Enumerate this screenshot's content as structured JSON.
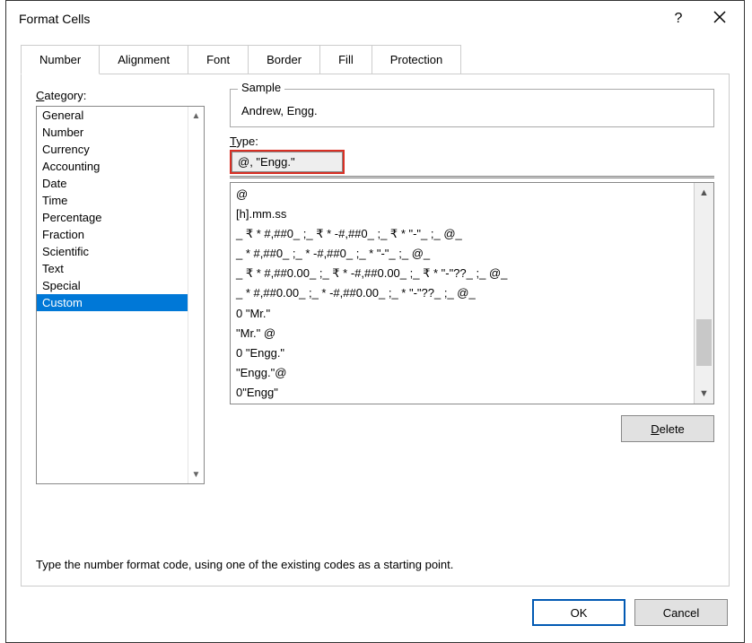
{
  "dialog": {
    "title": "Format Cells"
  },
  "tabs": {
    "number": "Number",
    "alignment": "Alignment",
    "font": "Font",
    "border": "Border",
    "fill": "Fill",
    "protection": "Protection"
  },
  "category_label": "Category:",
  "categories": [
    "General",
    "Number",
    "Currency",
    "Accounting",
    "Date",
    "Time",
    "Percentage",
    "Fraction",
    "Scientific",
    "Text",
    "Special",
    "Custom"
  ],
  "selected_category_index": 11,
  "sample": {
    "legend": "Sample",
    "value": "Andrew, Engg."
  },
  "type_label": "Type:",
  "type_value": "@, \"Engg.\"",
  "format_codes": [
    "@",
    "[h].mm.ss",
    "_ ₹ * #,##0_ ;_ ₹ * -#,##0_ ;_ ₹ * \"-\"_ ;_ @_",
    "_ * #,##0_ ;_ * -#,##0_ ;_ * \"-\"_ ;_ @_",
    "_ ₹ * #,##0.00_ ;_ ₹ * -#,##0.00_ ;_ ₹ * \"-\"??_ ;_ @_",
    "_ * #,##0.00_ ;_ * -#,##0.00_ ;_ * \"-\"??_ ;_ @_",
    "0 \"Mr.\"",
    "\"Mr.\" @",
    "0 \"Engg.\"",
    "\"Engg.\"@",
    "0\"Engg\""
  ],
  "delete_label": "Delete",
  "hint_text": "Type the number format code, using one of the existing codes as a starting point.",
  "ok_label": "OK",
  "cancel_label": "Cancel"
}
